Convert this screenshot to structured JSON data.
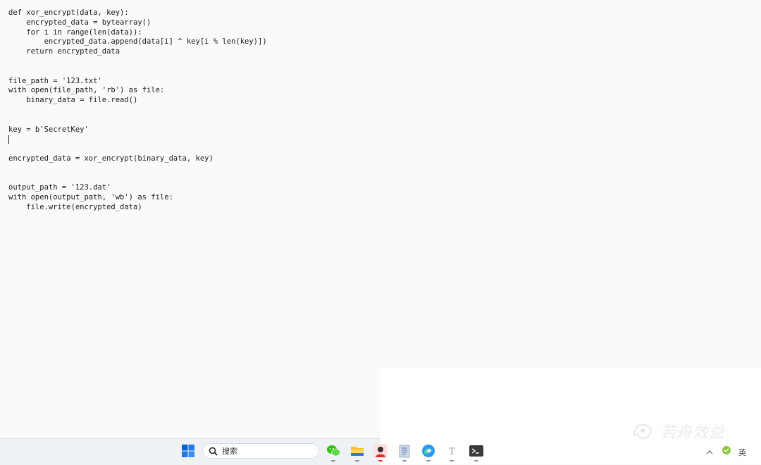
{
  "editor": {
    "lines": [
      "def xor_encrypt(data, key):",
      "    encrypted_data = bytearray()",
      "    for i in range(len(data)):",
      "        encrypted_data.append(data[i] ^ key[i % len(key)])",
      "    return encrypted_data",
      "",
      "",
      "file_path = '123.txt'",
      "with open(file_path, 'rb') as file:",
      "    binary_data = file.read()",
      "",
      "",
      "key = b'SecretKey'",
      "",
      "",
      "encrypted_data = xor_encrypt(binary_data, key)",
      "",
      "",
      "output_path = '123.dat'",
      "with open(output_path, 'wb') as file:",
      "    file.write(encrypted_data)"
    ],
    "caret_line": 13
  },
  "taskbar": {
    "search_label": "搜索",
    "icons": [
      "windows-start-icon",
      "search-icon",
      "wechat-icon",
      "file-explorer-icon",
      "avatar-app-icon",
      "notepad-icon",
      "edge-browser-icon",
      "text-app-icon",
      "terminal-icon"
    ],
    "tray_icons": [
      "chevron-up-icon",
      "green-shield-icon",
      "ime-icon"
    ],
    "tray_ime_label": "英"
  },
  "watermark": {
    "text": "若舟效益"
  },
  "colors": {
    "editor_bg": "#fafafa",
    "taskbar_bg": "#eef1f6",
    "accent_blue": "#0a64d8"
  }
}
